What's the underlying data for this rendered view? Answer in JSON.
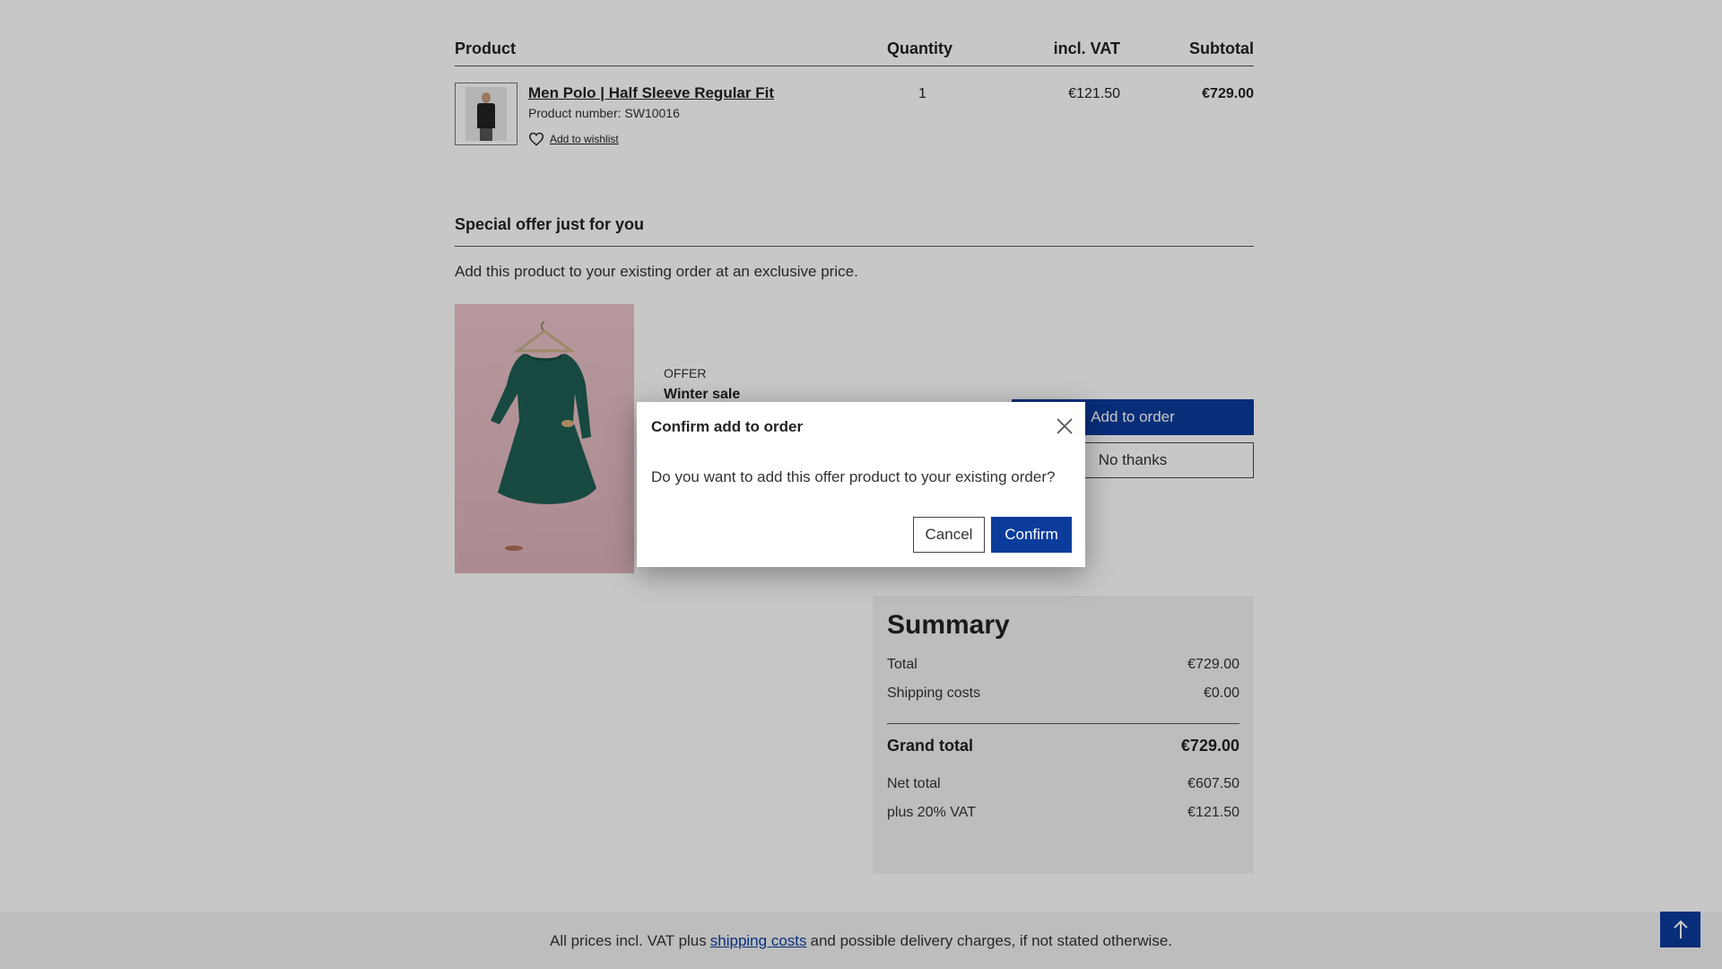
{
  "cart": {
    "headers": {
      "product": "Product",
      "quantity": "Quantity",
      "vat": "incl. VAT",
      "subtotal": "Subtotal"
    },
    "items": [
      {
        "name": "Men Polo | Half Sleeve Regular Fit",
        "number": "Product number: SW10016",
        "wishlist": "Add to wishlist",
        "quantity": "1",
        "vat": "€121.50",
        "subtotal": "€729.00"
      }
    ]
  },
  "offer": {
    "title": "Special offer just for you",
    "description": "Add this product to your existing order at an exclusive price.",
    "tag": "OFFER",
    "name": "Winter sale",
    "add_label": "Add to order",
    "decline_label": "No thanks"
  },
  "summary": {
    "title": "Summary",
    "total_label": "Total",
    "total_value": "€729.00",
    "shipping_label": "Shipping costs",
    "shipping_value": "€0.00",
    "grand_label": "Grand total",
    "grand_value": "€729.00",
    "net_label": "Net total",
    "net_value": "€607.50",
    "vat_label": "plus 20% VAT",
    "vat_value": "€121.50"
  },
  "footer": {
    "text_before": "All prices incl. VAT plus",
    "link": "shipping costs",
    "text_after": "and possible delivery charges, if not stated otherwise."
  },
  "modal": {
    "title": "Confirm add to order",
    "body": "Do you want to add this offer product to your existing order?",
    "cancel_label": "Cancel",
    "confirm_label": "Confirm"
  },
  "colors": {
    "accent": "#0b3c9c"
  },
  "icons": {
    "wishlist": "heart-icon",
    "close": "close-icon",
    "scroll_top": "arrow-up-icon"
  }
}
